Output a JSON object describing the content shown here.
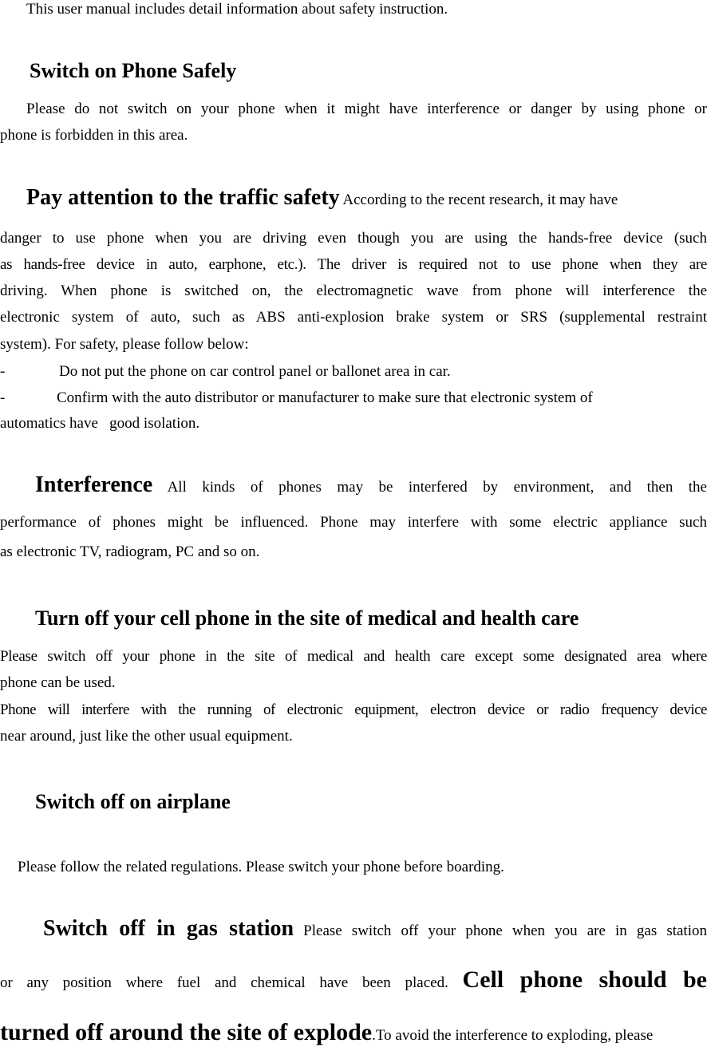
{
  "intro": "This user manual includes detail information about safety instruction.",
  "s1": {
    "heading": "Switch on Phone Safely",
    "lines": [
      "Please do not switch on your phone when it might have interference or danger by using phone or",
      "phone is forbidden in this area."
    ]
  },
  "s2": {
    "heading": "Pay attention to the traffic safety",
    "lead": " According to the recent research, it may have",
    "lines": [
      "danger  to use    phone when you are driving even though you are using the hands-free device (such",
      "as hands-free device in auto, earphone, etc.). The driver is required not to use phone when they are",
      "driving. When phone is switched on, the electromagnetic wave from phone will interference the",
      "electronic system of auto, such as ABS anti-explosion brake system or SRS (supplemental restraint",
      "system). For safety, please follow below:"
    ],
    "bullets": [
      {
        "mark": "-",
        "text": "Do not put the phone on car control panel or ballonet area in car."
      },
      {
        "mark": "-",
        "text": "Confirm with the auto distributor or manufacturer to make sure that electronic system of"
      }
    ],
    "tail": "automatics have   good isolation."
  },
  "s3": {
    "heading": "Interference",
    "lead": " All kinds of phones may be interfered by environment, and then the",
    "lines": [
      "performance of phones might be influenced. Phone may interfere with some electric appliance such",
      "as electronic TV, radiogram, PC and so on."
    ]
  },
  "s4": {
    "heading": "Turn off your cell phone in the site of medical and health care",
    "lines": [
      "Please switch off your phone in the site of medical and health care except some designated area where",
      "phone can be used.",
      "Phone will interfere with the running of electronic equipment, electron device or radio frequency device",
      "near around, just like the other usual equipment."
    ]
  },
  "s5": {
    "heading": "Switch off on airplane",
    "lines": [
      "Please follow the related regulations. Please switch your phone before boarding."
    ]
  },
  "s6": {
    "heading": "Switch off in gas station",
    "lead": " Please switch off your phone when you are in gas station",
    "line2": "or any position where fuel and chemical have been placed.",
    "bold2": "Cell phone should be",
    "bold3": "turned off around the site of explode",
    "tail3": ".To avoid the interference to exploding, please"
  }
}
